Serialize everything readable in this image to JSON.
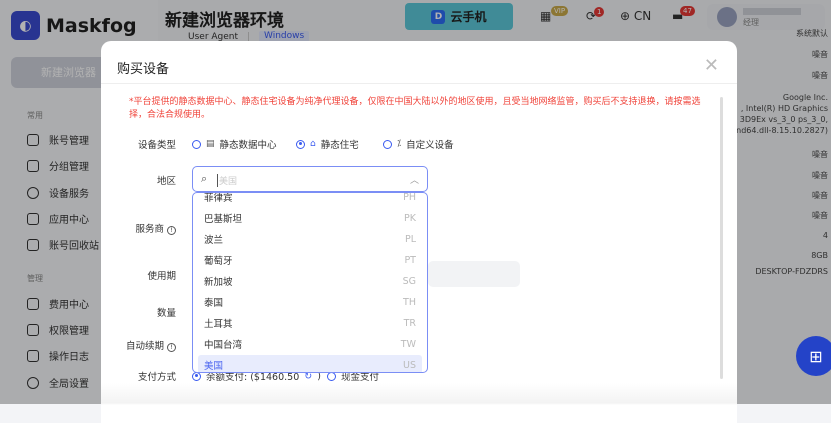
{
  "app": {
    "name": "Maskfog",
    "page_title": "新建浏览器环境",
    "new_button": "新建浏览器",
    "bg_field_label": "User Agent",
    "bg_field_value": "Windows"
  },
  "sidebar": {
    "groups": [
      {
        "label": "常用",
        "items": [
          {
            "label": "账号管理",
            "icon": "folder-icon"
          },
          {
            "label": "分组管理",
            "icon": "folder-open-icon"
          },
          {
            "label": "设备服务",
            "icon": "location-icon"
          },
          {
            "label": "应用中心",
            "icon": "box-icon"
          },
          {
            "label": "账号回收站",
            "icon": "trash-icon"
          }
        ]
      },
      {
        "label": "管理",
        "items": [
          {
            "label": "费用中心",
            "icon": "dollar-icon"
          },
          {
            "label": "权限管理",
            "icon": "shield-icon"
          },
          {
            "label": "操作日志",
            "icon": "clipboard-icon"
          },
          {
            "label": "全局设置",
            "icon": "settings-icon"
          }
        ]
      }
    ]
  },
  "header": {
    "cloud_phone": "云手机",
    "vip": "VIP",
    "sync_badge": "1",
    "lang": "CN",
    "msg_badge": "47",
    "user_role": "经理"
  },
  "bg_values": [
    "系统默认",
    "噪音",
    "噪音",
    "Google Inc.",
    ", Intel(R) HD Graphics",
    "3D9Ex vs_3_0 ps_3_0,",
    "nd64.dll-8.15.10.2827)",
    "噪音",
    "噪音",
    "噪音",
    "噪音",
    "4",
    "8GB",
    "DESKTOP-FDZDRS"
  ],
  "modal": {
    "title": "购买设备",
    "notice": "*平台提供的静态数据中心、静态住宅设备为纯净代理设备，仅限在中国大陆以外的地区使用，且受当地网络监管，购买后不支持退换，请按需选择，合法合规使用。",
    "labels": {
      "device_type": "设备类型",
      "region": "地区",
      "provider": "服务商",
      "period": "使用期",
      "quantity": "数量",
      "auto_renew": "自动续期",
      "payment": "支付方式"
    },
    "device_types": [
      {
        "label": "静态数据中心",
        "selected": false
      },
      {
        "label": "静态住宅",
        "selected": true
      },
      {
        "label": "自定义设备",
        "selected": false
      }
    ],
    "region": {
      "placeholder": "美国",
      "options": [
        {
          "name": "菲律宾",
          "code": "PH"
        },
        {
          "name": "巴基斯坦",
          "code": "PK"
        },
        {
          "name": "波兰",
          "code": "PL"
        },
        {
          "name": "葡萄牙",
          "code": "PT"
        },
        {
          "name": "新加坡",
          "code": "SG"
        },
        {
          "name": "泰国",
          "code": "TH"
        },
        {
          "name": "土耳其",
          "code": "TR"
        },
        {
          "name": "中国台湾",
          "code": "TW"
        },
        {
          "name": "美国",
          "code": "US",
          "selected": true
        }
      ]
    },
    "payment": {
      "balance": "余额支付: ($1460.50",
      "cash": "现金支付"
    }
  },
  "colors": {
    "accent": "#3a5bf0",
    "notice": "#f0433a",
    "brand": "#2443c8"
  }
}
